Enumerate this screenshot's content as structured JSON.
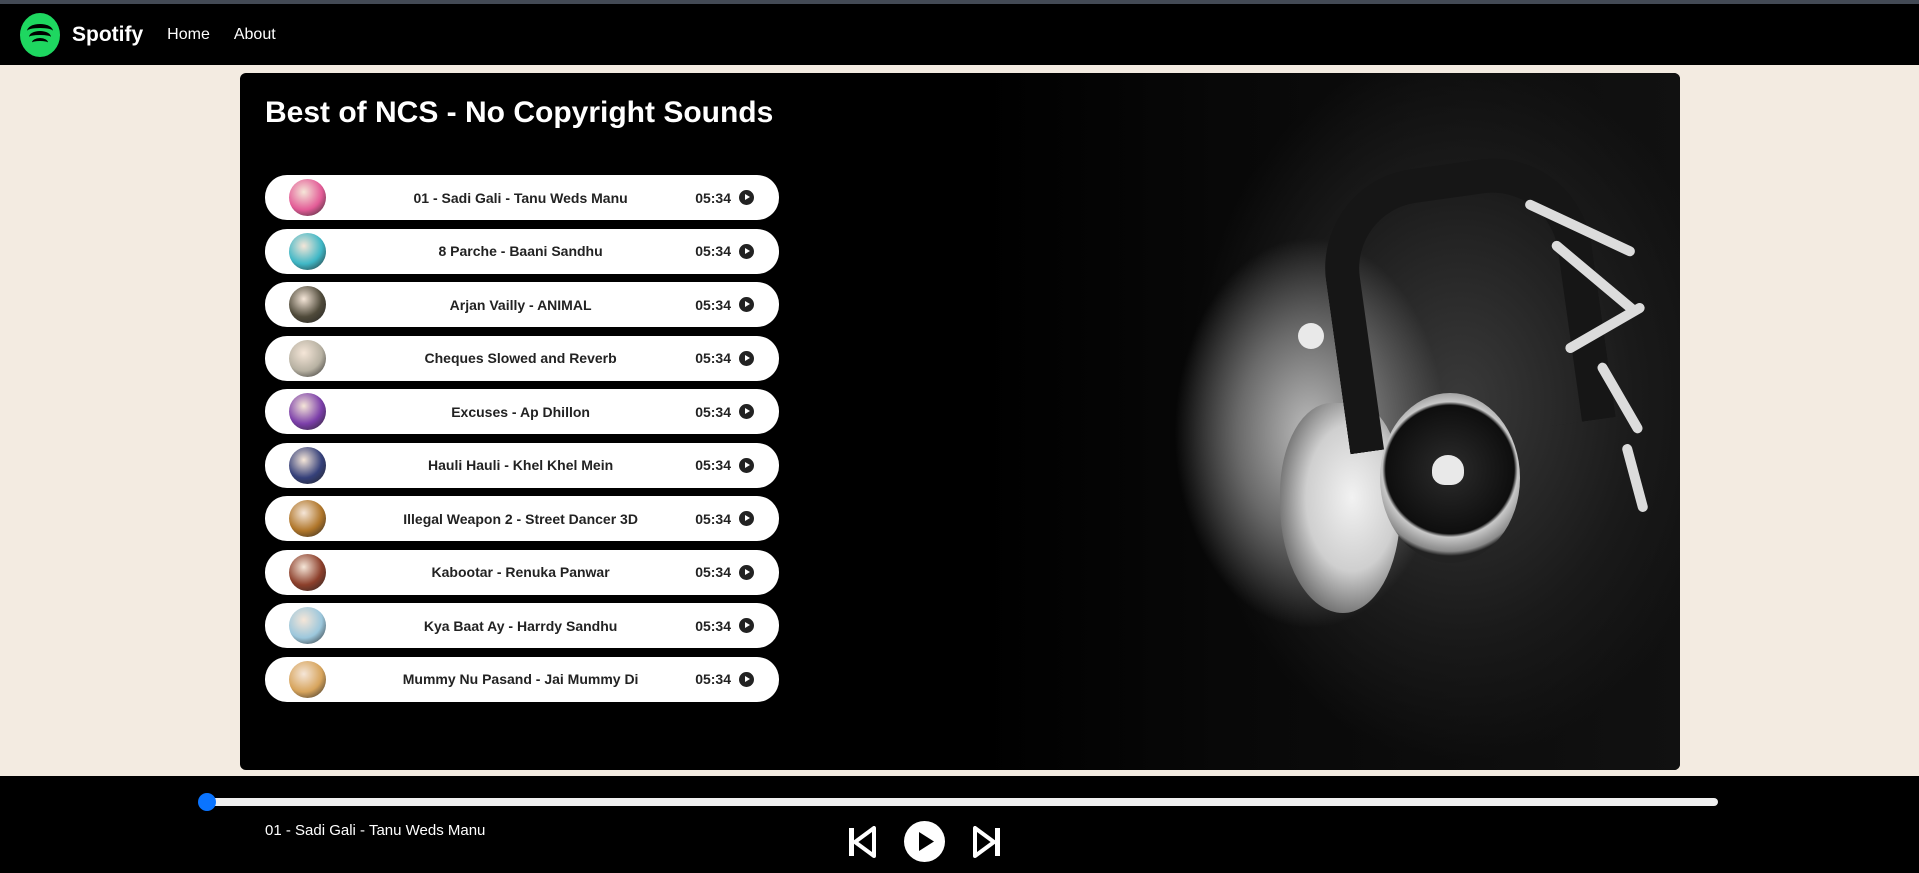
{
  "nav": {
    "brand": "Spotify",
    "links": [
      "Home",
      "About"
    ]
  },
  "playlist": {
    "title": "Best of NCS - No Copyright Sounds",
    "songs": [
      {
        "name": "01 - Sadi Gali - Tanu Weds Manu",
        "time": "05:34",
        "cover_color": "#e35c97"
      },
      {
        "name": "8 Parche - Baani Sandhu",
        "time": "05:34",
        "cover_color": "#3fb7c6"
      },
      {
        "name": "Arjan Vailly - ANIMAL",
        "time": "05:34",
        "cover_color": "#4f4a3a"
      },
      {
        "name": "Cheques Slowed and Reverb",
        "time": "05:34",
        "cover_color": "#b7b1a2"
      },
      {
        "name": "Excuses - Ap Dhillon",
        "time": "05:34",
        "cover_color": "#7b3ea9"
      },
      {
        "name": "Hauli Hauli - Khel Khel Mein",
        "time": "05:34",
        "cover_color": "#35407a"
      },
      {
        "name": "Illegal Weapon 2 - Street Dancer 3D",
        "time": "05:34",
        "cover_color": "#b0762a"
      },
      {
        "name": "Kabootar - Renuka Panwar",
        "time": "05:34",
        "cover_color": "#8c3f2b"
      },
      {
        "name": "Kya Baat Ay - Harrdy Sandhu",
        "time": "05:34",
        "cover_color": "#9cc7dc"
      },
      {
        "name": "Mummy Nu Pasand - Jai Mummy Di",
        "time": "05:34",
        "cover_color": "#d7a45c"
      }
    ]
  },
  "player": {
    "now_playing": "01 - Sadi Gali - Tanu Weds Manu",
    "progress": 0,
    "accent": "#0a74ff"
  },
  "colors": {
    "brand": "#1ed760",
    "page_bg": "#f3ebe1"
  },
  "icons": [
    "spotify-logo-icon",
    "play-icon",
    "previous-icon",
    "next-icon"
  ]
}
